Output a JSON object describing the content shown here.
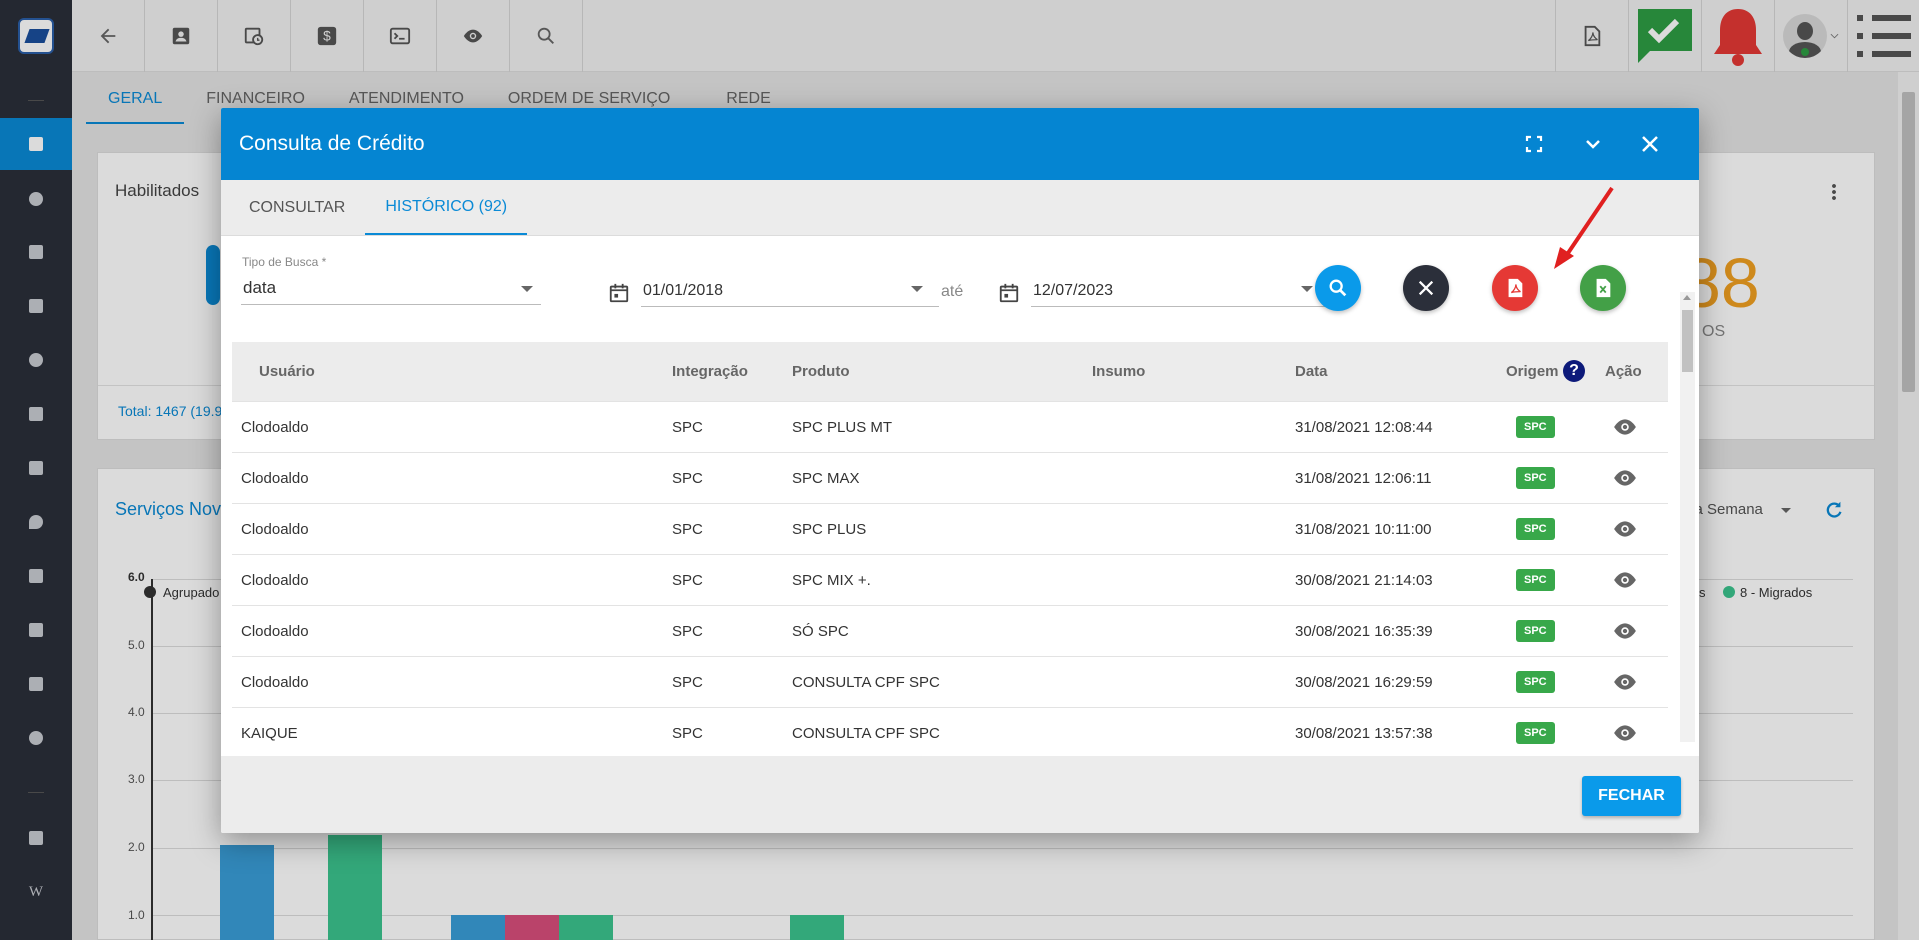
{
  "sidebar": {
    "items": [
      "dashboard",
      "analytics",
      "contacts",
      "board",
      "schedule",
      "packages",
      "billing",
      "locations",
      "reports",
      "servers",
      "documents",
      "settings",
      "videos",
      "wiki"
    ]
  },
  "topbar": {
    "icons": [
      "back-icon",
      "contact-card-icon",
      "clock-calendar-icon",
      "dollar-icon",
      "terminal-icon",
      "eye-icon",
      "search-icon"
    ],
    "right_icons": [
      "pdf-icon",
      "check-message-icon",
      "alarm-bell-icon",
      "avatar",
      "menu-list-icon"
    ]
  },
  "page_tabs": [
    "GERAL",
    "FINANCEIRO",
    "ATENDIMENTO",
    "ORDEM DE SERVIÇO",
    "REDE"
  ],
  "background": {
    "card1_title": "Habilitados",
    "card1_footer": "Total: 1467 (19.9",
    "card1_big_number": "88",
    "card1_small_text": "OS",
    "card2_title": "Serviços Nove",
    "card2_period": "sa Semana",
    "chart_y_ticks": [
      "6.0",
      "5.0",
      "4.0",
      "3.0",
      "2.0",
      "1.0"
    ],
    "legend_left": "Agrupado",
    "legend_right_a": "s",
    "legend_right_b": "8 - Migrados"
  },
  "modal": {
    "title": "Consulta de Crédito",
    "tabs": [
      {
        "label": "CONSULTAR",
        "active": false
      },
      {
        "label": "HISTÓRICO (92)",
        "active": true
      }
    ],
    "filters": {
      "tipo_label": "Tipo de Busca *",
      "tipo_value": "data",
      "date_from": "01/01/2018",
      "ate_label": "até",
      "date_to": "12/07/2023"
    },
    "table": {
      "headers": [
        "Usuário",
        "Integração",
        "Produto",
        "Insumo",
        "Data",
        "Origem",
        "Ação"
      ],
      "rows": [
        {
          "usuario": "Clodoaldo",
          "integracao": "SPC",
          "produto": "SPC PLUS MT",
          "insumo": "",
          "data": "31/08/2021 12:08:44",
          "origem": "SPC"
        },
        {
          "usuario": "Clodoaldo",
          "integracao": "SPC",
          "produto": "SPC MAX",
          "insumo": "",
          "data": "31/08/2021 12:06:11",
          "origem": "SPC"
        },
        {
          "usuario": "Clodoaldo",
          "integracao": "SPC",
          "produto": "SPC PLUS",
          "insumo": "",
          "data": "31/08/2021 10:11:00",
          "origem": "SPC"
        },
        {
          "usuario": "Clodoaldo",
          "integracao": "SPC",
          "produto": "SPC MIX +.",
          "insumo": "",
          "data": "30/08/2021 21:14:03",
          "origem": "SPC"
        },
        {
          "usuario": "Clodoaldo",
          "integracao": "SPC",
          "produto": "SÓ SPC",
          "insumo": "",
          "data": "30/08/2021 16:35:39",
          "origem": "SPC"
        },
        {
          "usuario": "Clodoaldo",
          "integracao": "SPC",
          "produto": "CONSULTA CPF SPC",
          "insumo": "",
          "data": "30/08/2021 16:29:59",
          "origem": "SPC"
        },
        {
          "usuario": "KAIQUE",
          "integracao": "SPC",
          "produto": "CONSULTA CPF SPC",
          "insumo": "",
          "data": "30/08/2021 13:57:38",
          "origem": "SPC"
        }
      ]
    },
    "footer_button": "FECHAR"
  },
  "colors": {
    "primary": "#0585d2",
    "search_btn": "#0a9aea",
    "clear_btn": "#2b2f3a",
    "pdf_btn": "#e53935",
    "excel_btn": "#43a047",
    "badge": "#38a84a",
    "arrow": "#e02020"
  }
}
